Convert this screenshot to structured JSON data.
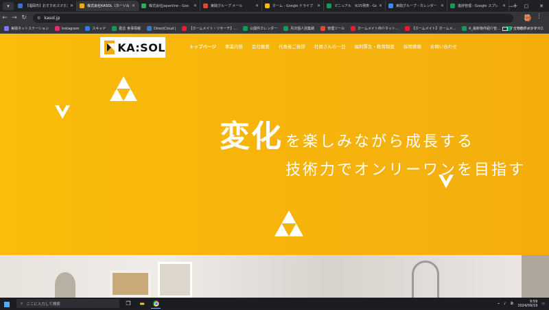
{
  "tabs": [
    {
      "label": "【福岡市】おすすめスマホアプリ",
      "color": "#3b6fd6",
      "active": false
    },
    {
      "label": "株式会社KASOL（カーソル）",
      "color": "#f3a912",
      "active": true
    },
    {
      "label": "株式会社Japanline - Goo",
      "color": "#34a853",
      "active": false
    },
    {
      "label": "実践グループ メール",
      "color": "#ea4335",
      "active": false
    },
    {
      "label": "ホーム - Google ドライブ",
      "color": "#fbbc05",
      "active": false
    },
    {
      "label": "マニュアル　9/25発表 - Go",
      "color": "#0f9d58",
      "active": false
    },
    {
      "label": "実践グループ・カレンダー - G",
      "color": "#4285f4",
      "active": false
    },
    {
      "label": "進捗管理 - Google スプレ",
      "color": "#0f9d58",
      "active": false
    }
  ],
  "address": {
    "url": "kasol.jp"
  },
  "extension_avatar": "おかもと",
  "bookmarks": [
    {
      "label": "実践ネットステーション",
      "color": "#7a7aff"
    },
    {
      "label": "Instagram",
      "color": "#e1306c"
    },
    {
      "label": "スキャナ",
      "color": "#2b7de9"
    },
    {
      "label": "勤怠 食事情報",
      "color": "#0f9d58"
    },
    {
      "label": "DirectCloud |",
      "color": "#3b7bd6"
    },
    {
      "label": "【ホームメイト・リサーチ】...",
      "color": "#d9262b"
    },
    {
      "label": "公開件カレンダー",
      "color": "#0f9d58"
    },
    {
      "label": "月次個人別集績",
      "color": "#0f9d58"
    },
    {
      "label": "管理ツール",
      "color": "#ea4335"
    },
    {
      "label": "ホームメイト仲介ネット...",
      "color": "#d9262b"
    },
    {
      "label": "【ホームメイト】ホームメ...",
      "color": "#d9262b"
    },
    {
      "label": "K_最新物件紹介管...",
      "color": "#0f9d58"
    },
    {
      "label": "土地物件ボックス...",
      "color": "#0f9d58"
    }
  ],
  "bookmarks_all": "すべてのブックマーク",
  "site": {
    "logo_text": "KA:SOL",
    "nav": [
      "トップページ",
      "事業内容",
      "会社概要",
      "代表者ご挨拶",
      "社員さんの一日",
      "福利厚生・教育制度",
      "採用情報",
      "お問い合わせ"
    ],
    "hero_big": "変化",
    "hero_small": "を楽しみながら成長する",
    "hero_line2": "技術力でオンリーワンを目指す"
  },
  "taskbar": {
    "search_placeholder": "ここに入力して検索",
    "time": "9:59",
    "date": "2024/09/19"
  }
}
